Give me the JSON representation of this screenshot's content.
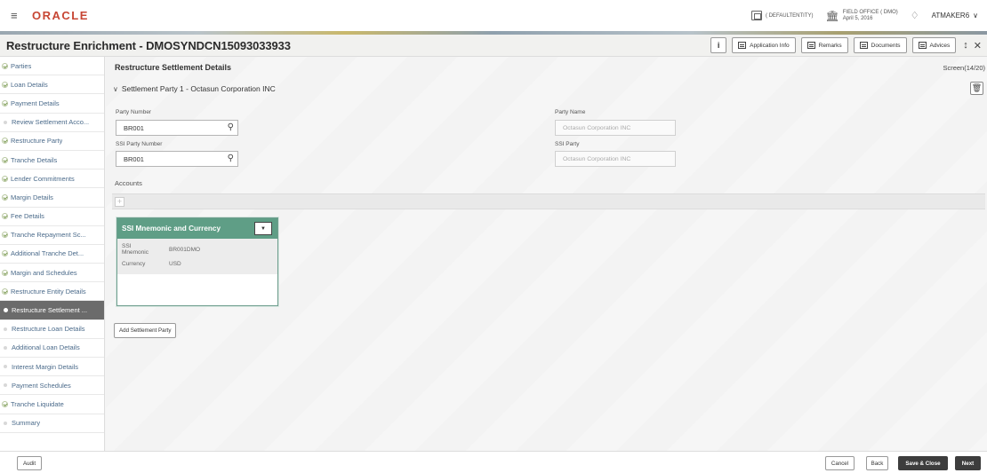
{
  "topbar": {
    "logo": "ORACLE",
    "entity": "( DEFAULTENTITY)",
    "office_line1": "FIELD OFFICE ( DMO)",
    "office_line2": "April 5, 2016",
    "user": "ATMAKER6"
  },
  "header": {
    "title": "Restructure Enrichment - DMOSYNDCN15093033933",
    "buttons": {
      "info": "i",
      "app_info": "Application Info",
      "remarks": "Remarks",
      "documents": "Documents",
      "advices": "Advices"
    }
  },
  "sidebar": {
    "items": [
      {
        "label": "Parties",
        "state": "done"
      },
      {
        "label": "Loan Details",
        "state": "done"
      },
      {
        "label": "Payment Details",
        "state": "done"
      },
      {
        "label": "Review Settlement Acco...",
        "state": "pending"
      },
      {
        "label": "Restructure Party",
        "state": "done"
      },
      {
        "label": "Tranche Details",
        "state": "done"
      },
      {
        "label": "Lender Commitments",
        "state": "done"
      },
      {
        "label": "Margin Details",
        "state": "done"
      },
      {
        "label": "Fee Details",
        "state": "done"
      },
      {
        "label": "Tranche Repayment Sc...",
        "state": "done"
      },
      {
        "label": "Additional Tranche Det...",
        "state": "done"
      },
      {
        "label": "Margin and Schedules",
        "state": "done"
      },
      {
        "label": "Restructure Entity Details",
        "state": "done"
      },
      {
        "label": "Restructure Settlement ...",
        "state": "active"
      },
      {
        "label": "Restructure Loan Details",
        "state": "pending"
      },
      {
        "label": "Additional Loan Details",
        "state": "pending"
      },
      {
        "label": "Interest Margin Details",
        "state": "pending"
      },
      {
        "label": "Payment Schedules",
        "state": "pending"
      },
      {
        "label": "Tranche Liquidate",
        "state": "done"
      },
      {
        "label": "Summary",
        "state": "pending"
      }
    ]
  },
  "main": {
    "section_title": "Restructure Settlement Details",
    "screen": "Screen(14/20)",
    "party_heading": "Settlement Party 1 - Octasun Corporation INC",
    "party_number_label": "Party Number",
    "party_number_value": "BR001",
    "party_name_label": "Party Name",
    "party_name_value": "Octasun Corporation INC",
    "ssi_party_number_label": "SSI Party Number",
    "ssi_party_number_value": "BR001",
    "ssi_party_label": "SSI Party",
    "ssi_party_value": "Octasun Corporation INC",
    "accounts_label": "Accounts",
    "card": {
      "title": "SSI Mnemonic and Currency",
      "rows": [
        {
          "key": "SSI Mnemonic",
          "value": "BR001DMO"
        },
        {
          "key": "Currency",
          "value": "USD"
        }
      ]
    },
    "add_party_label": "Add Settlement Party"
  },
  "footer": {
    "audit": "Audit",
    "cancel": "Cancel",
    "back": "Back",
    "save_close": "Save & Close",
    "next": "Next"
  }
}
